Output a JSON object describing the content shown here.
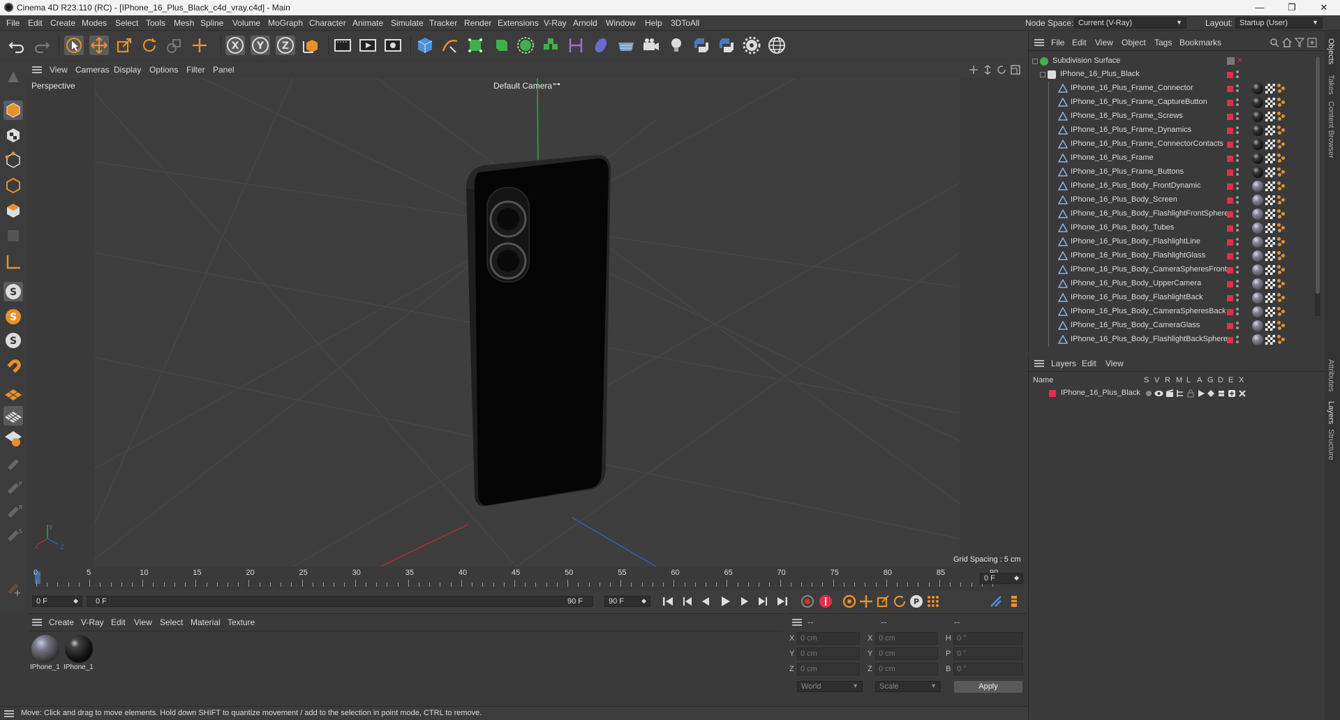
{
  "titlebar": {
    "title": "Cinema 4D R23.110 (RC) - [IPhone_16_Plus_Black_c4d_vray.c4d] - Main",
    "minimize": "—",
    "maximize": "❐",
    "close": "✕"
  },
  "menu": [
    "File",
    "Edit",
    "Create",
    "Modes",
    "Select",
    "Tools",
    "Mesh",
    "Spline",
    "Volume",
    "MoGraph",
    "Character",
    "Animate",
    "Simulate",
    "Tracker",
    "Render",
    "Extensions",
    "V-Ray",
    "Arnold",
    "Window",
    "Help",
    "3DToAll"
  ],
  "topright": {
    "node_space_label": "Node Space:",
    "node_space_value": "Current (V-Ray)",
    "layout_label": "Layout:",
    "layout_value": "Startup (User)"
  },
  "viewport": {
    "menu": [
      "View",
      "Cameras",
      "Display",
      "Options",
      "Filter",
      "Panel"
    ],
    "view_name": "Perspective",
    "camera": "Default Camera",
    "grid_spacing": "Grid Spacing : 5 cm",
    "axis_x": "X",
    "axis_y": "Y",
    "axis_z": "Z"
  },
  "timeline": {
    "ticks": [
      "0",
      "5",
      "10",
      "15",
      "20",
      "25",
      "30",
      "35",
      "40",
      "45",
      "50",
      "55",
      "60",
      "65",
      "70",
      "75",
      "80",
      "85",
      "90"
    ],
    "current_frame": "0 F",
    "start_field": "0 F",
    "range_start": "0 F",
    "range_end": "90 F",
    "end_field": "90 F",
    "current_playhead": 0,
    "max": 90
  },
  "materials": {
    "menu": [
      "Create",
      "V-Ray",
      "Edit",
      "View",
      "Select",
      "Material",
      "Texture"
    ],
    "items": [
      {
        "label": "IPhone_1"
      },
      {
        "label": "IPhone_1"
      }
    ]
  },
  "coords": {
    "header_dashes": [
      "--",
      "--",
      "--"
    ],
    "rows": [
      {
        "l1": "X",
        "v1": "0 cm",
        "l2": "X",
        "v2": "0 cm",
        "l3": "H",
        "v3": "0 °"
      },
      {
        "l1": "Y",
        "v1": "0 cm",
        "l2": "Y",
        "v2": "0 cm",
        "l3": "P",
        "v3": "0 °"
      },
      {
        "l1": "Z",
        "v1": "0 cm",
        "l2": "Z",
        "v2": "0 cm",
        "l3": "B",
        "v3": "0 °"
      }
    ],
    "world": "World",
    "scale": "Scale",
    "apply": "Apply"
  },
  "status": "Move: Click and drag to move elements. Hold down SHIFT to quantize movement / add to the selection in point mode, CTRL to remove.",
  "objects": {
    "menu": [
      "File",
      "Edit",
      "View",
      "Object",
      "Tags",
      "Bookmarks"
    ],
    "root": "Subdivision Surface",
    "group": "IPhone_16_Plus_Black",
    "items": [
      "IPhone_16_Plus_Frame_Connector",
      "IPhone_16_Plus_Frame_CaptureButton",
      "IPhone_16_Plus_Frame_Screws",
      "IPhone_16_Plus_Frame_Dynamics",
      "IPhone_16_Plus_Frame_ConnectorContacts",
      "IPhone_16_Plus_Frame",
      "IPhone_16_Plus_Frame_Buttons",
      "IPhone_16_Plus_Body_FrontDynamic",
      "IPhone_16_Plus_Body_Screen",
      "IPhone_16_Plus_Body_FlashlightFrontSphere",
      "IPhone_16_Plus_Body_Tubes",
      "IPhone_16_Plus_Body_FlashlightLine",
      "IPhone_16_Plus_Body_FlashlightGlass",
      "IPhone_16_Plus_Body_CameraSpheresFront",
      "IPhone_16_Plus_Body_UpperCamera",
      "IPhone_16_Plus_Body_FlashlightBack",
      "IPhone_16_Plus_Body_CameraSpheresBack",
      "IPhone_16_Plus_Body_CameraGlass",
      "IPhone_16_Plus_Body_FlashlightBackSphere"
    ]
  },
  "layers": {
    "menu": [
      "Layers",
      "Edit",
      "View"
    ],
    "name_header": "Name",
    "cols": [
      "S",
      "V",
      "R",
      "M",
      "L",
      "A",
      "G",
      "D",
      "E",
      "X"
    ],
    "items": [
      "IPhone_16_Plus_Black"
    ]
  },
  "sidetabs": [
    "Objects",
    "Takes",
    "Content Browser",
    "Attributes",
    "Layers",
    "Structure"
  ],
  "colors": {
    "accent_red": "#e0304a",
    "accent_orange": "#e8902e",
    "accent_blue": "#4a90d9"
  }
}
